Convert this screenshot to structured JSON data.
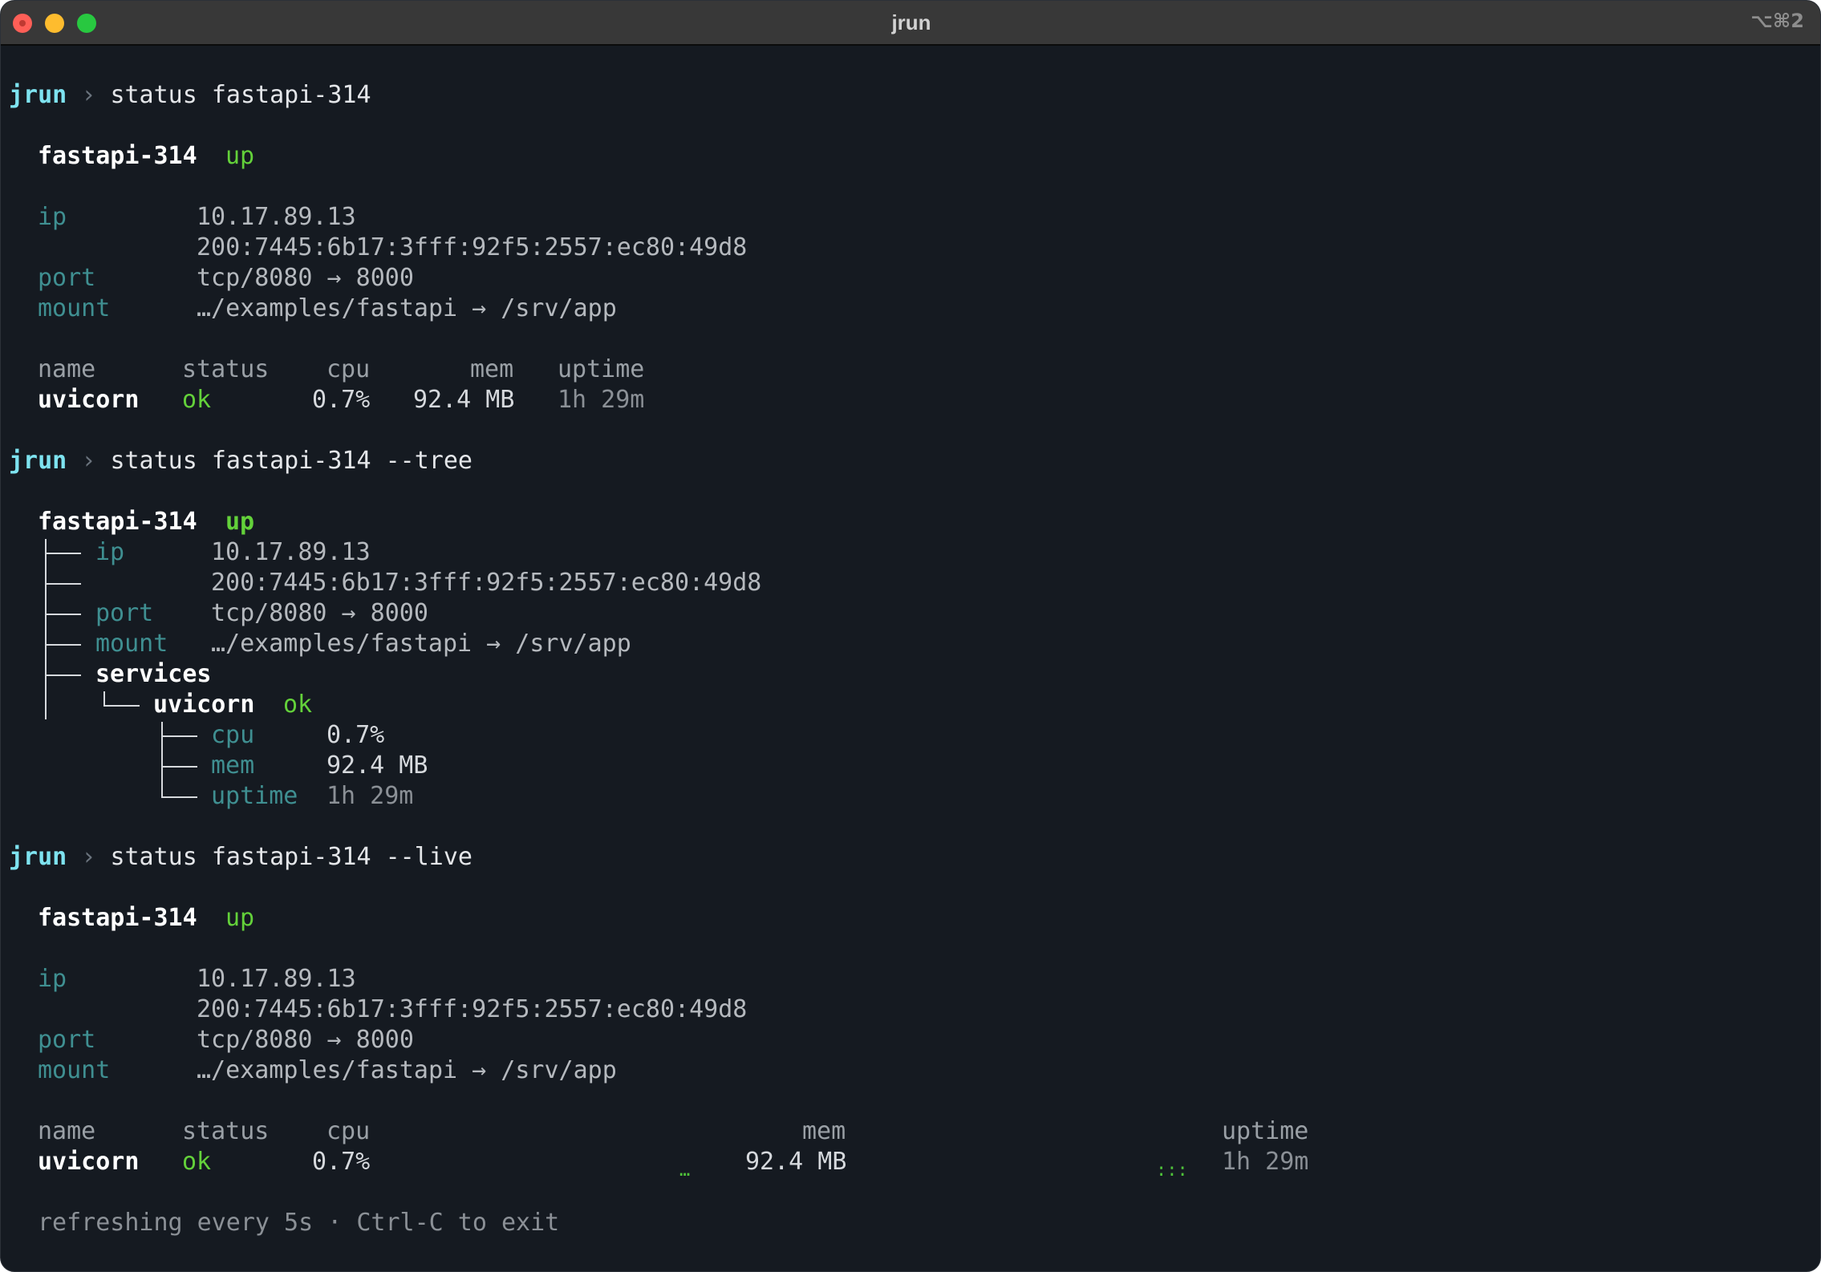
{
  "window": {
    "title": "jrun",
    "shortcut": "⌥⌘2"
  },
  "prompt": "jrun",
  "prompt_sep": "›",
  "commands": {
    "c1": "status fastapi-314",
    "c2": "status fastapi-314 --tree",
    "c3": "status fastapi-314 --live"
  },
  "app": {
    "name": "fastapi-314",
    "state": "up",
    "ip_label": "ip",
    "ipv4": "10.17.89.13",
    "ipv6": "200:7445:6b17:3fff:92f5:2557:ec80:49d8",
    "port_label": "port",
    "port": "tcp/8080 → 8000",
    "mount_label": "mount",
    "mount": "…/examples/fastapi → /srv/app"
  },
  "table": {
    "headers": {
      "name": "name",
      "status": "status",
      "cpu": "cpu",
      "mem": "mem",
      "uptime": "uptime"
    }
  },
  "service": {
    "name": "uvicorn",
    "status": "ok",
    "cpu": "0.7%",
    "mem": "92.4 MB",
    "uptime": "1h 29m"
  },
  "tree": {
    "services_label": "services",
    "cpu_label": "cpu",
    "mem_label": "mem",
    "uptime_label": "uptime"
  },
  "live": {
    "spark_mem": "…",
    "spark_uptime": ":::",
    "footer": "refreshing every 5s · Ctrl-C to exit"
  },
  "colors": {
    "background": "#151a21",
    "prompt": "#7ee3f0",
    "ok": "#63d13a",
    "label": "#3f8f91"
  }
}
